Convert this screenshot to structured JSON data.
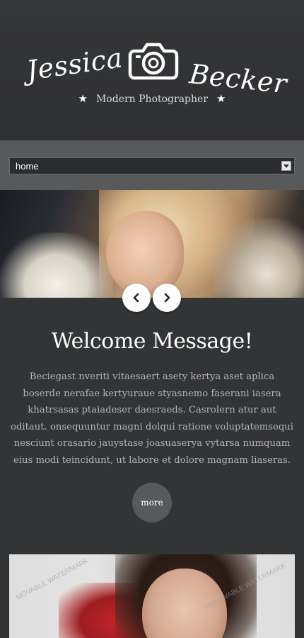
{
  "header": {
    "logo_first": "Jessica",
    "logo_last": "Becker",
    "logo_icon": "camera-icon",
    "tagline": "Modern Photographer"
  },
  "nav": {
    "selected": "home",
    "icon": "chevron-down-icon"
  },
  "slider": {
    "prev_icon": "chevron-left-icon",
    "next_icon": "chevron-right-icon"
  },
  "welcome": {
    "title": "Welcome Message!",
    "text": "Beciegast nveriti vitaesaert asety kertya aset aplica boserde nerafae kertyuraue styasnemo faserani iasera khatrsasas ptaiadeser daesraeds. Casrolern atur aut oditaut. onsequuntur magni dolqui ratione voluptatemsequi nesciunt orasario jauystase joasuaserya vytarsa numquam eius modi teincidunt, ut labore et dolore magnam liaseras.",
    "more_label": "more"
  },
  "photo2": {
    "watermark": "MOVABLE WATERMARK",
    "watermark2": "REMOVABLE WATERMARK"
  },
  "colors": {
    "background": "#333436",
    "nav_band": "#58595b",
    "button": "#58595b",
    "text": "#b4b4b6",
    "heading": "#ffffff"
  }
}
